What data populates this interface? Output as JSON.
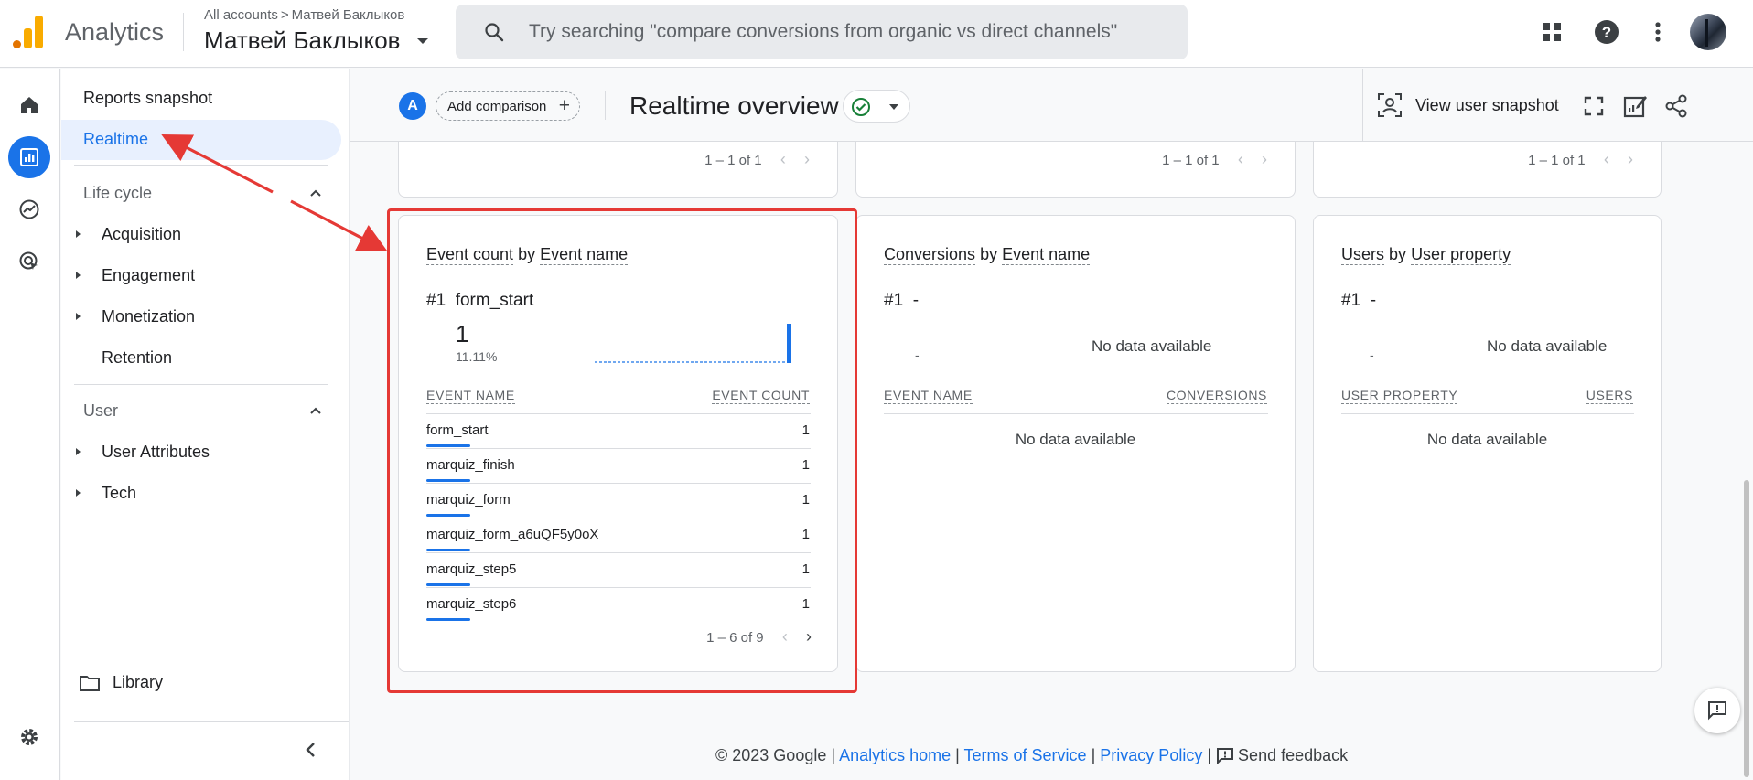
{
  "header": {
    "app_title": "Analytics",
    "breadcrumb_all": "All accounts",
    "breadcrumb_account": "Матвей Баклыков",
    "account_name": "Матвей Баклыков",
    "search_placeholder": "Try searching \"compare conversions from organic vs direct channels\""
  },
  "rail": {
    "items": [
      "home-icon",
      "reports-icon",
      "explore-icon",
      "advertising-icon",
      "settings-icon"
    ],
    "active": "reports-icon"
  },
  "nav": {
    "reports_snapshot": "Reports snapshot",
    "realtime": "Realtime",
    "lifecycle": {
      "title": "Life cycle",
      "items": [
        "Acquisition",
        "Engagement",
        "Monetization",
        "Retention"
      ]
    },
    "user": {
      "title": "User",
      "items": [
        "User Attributes",
        "Tech"
      ]
    },
    "library": "Library"
  },
  "toolbar": {
    "comparison_badge": "A",
    "add_comparison": "Add comparison",
    "page_title": "Realtime overview",
    "view_user_snapshot": "View user snapshot"
  },
  "top_cards": {
    "pagers": [
      "1 – 1 of 1",
      "1 – 1 of 1",
      "1 – 1 of 1"
    ]
  },
  "event_card": {
    "title_metric": "Event count",
    "title_by": "by",
    "title_dim": "Event name",
    "rank": "#1",
    "top_name": "form_start",
    "top_value": "1",
    "top_pct": "11.11%",
    "col_name": "EVENT NAME",
    "col_value": "EVENT COUNT",
    "rows": [
      {
        "name": "form_start",
        "value": "1"
      },
      {
        "name": "marquiz_finish",
        "value": "1"
      },
      {
        "name": "marquiz_form",
        "value": "1"
      },
      {
        "name": "marquiz_form_a6uQF5y0oX",
        "value": "1"
      },
      {
        "name": "marquiz_step5",
        "value": "1"
      },
      {
        "name": "marquiz_step6",
        "value": "1"
      }
    ],
    "pager": "1 – 6 of 9"
  },
  "conversions_card": {
    "title_metric": "Conversions",
    "title_by": "by",
    "title_dim": "Event name",
    "rank": "#1",
    "top_name": "-",
    "placeholder_dash": "-",
    "chart_no_data": "No data available",
    "col_name": "EVENT NAME",
    "col_value": "CONVERSIONS",
    "table_no_data": "No data available"
  },
  "users_card": {
    "title_metric": "Users",
    "title_by": "by",
    "title_dim": "User property",
    "rank": "#1",
    "top_name": "-",
    "placeholder_dash": "-",
    "chart_no_data": "No data available",
    "col_name": "USER PROPERTY",
    "col_value": "USERS",
    "table_no_data": "No data available"
  },
  "footer": {
    "copyright": "© 2023 Google",
    "sep": "|",
    "analytics_home": "Analytics home",
    "terms": "Terms of Service",
    "privacy": "Privacy Policy",
    "send_feedback": "Send feedback"
  },
  "colors": {
    "accent": "#1a73e8",
    "annotation": "#e53935",
    "active_nav_bg": "#e8f0fe"
  }
}
